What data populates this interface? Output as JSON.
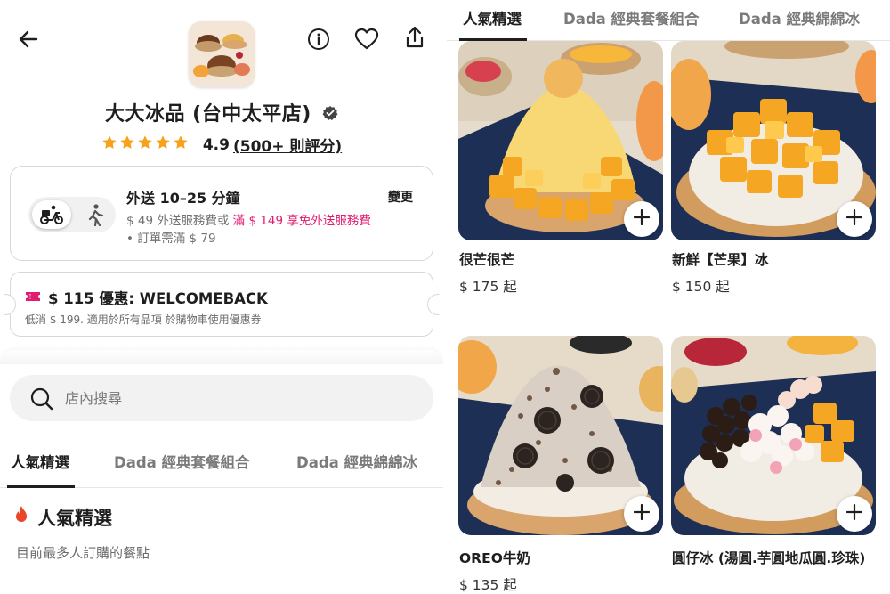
{
  "store": {
    "name": "大大冰品 (台中太平店)",
    "rating": "4.9",
    "rating_count": "(500+ 則評分)",
    "stars": 5
  },
  "delivery": {
    "title": "外送 10–25 分鐘",
    "change_label": "變更",
    "fee_prefix": "$ 49 外送服務費或",
    "fee_highlight": "滿 $ 149 享免外送服務費",
    "minimum": "• 訂單需滿 $ 79"
  },
  "promo": {
    "title": "$ 115 優惠: WELCOMEBACK",
    "desc": "低消 $ 199. 適用於所有品項 於購物車使用優惠券"
  },
  "search": {
    "placeholder": "店內搜尋"
  },
  "tabs": [
    {
      "label": "人氣精選"
    },
    {
      "label": "Dada 經典套餐組合"
    },
    {
      "label": "Dada 經典綿綿冰"
    }
  ],
  "section": {
    "title": "人氣精選",
    "subtitle": "目前最多人訂購的餐點"
  },
  "menu_items": [
    {
      "name": "很芒很芒",
      "price": "$ 175 起"
    },
    {
      "name": "新鮮【芒果】冰",
      "price": "$ 150 起"
    },
    {
      "name": "OREO牛奶",
      "price": "$ 135 起"
    },
    {
      "name": "圓仔冰 (湯圓.芋圓地瓜圓.珍珠)",
      "price": ""
    }
  ],
  "colors": {
    "accent_pink": "#e21b70",
    "star_orange": "#f7a21b",
    "text_dark": "#1e1e1e"
  },
  "icons": [
    "back-arrow-icon",
    "info-icon",
    "heart-icon",
    "share-icon",
    "verified-badge-icon",
    "scooter-icon",
    "walk-icon",
    "ticket-icon",
    "search-icon",
    "fire-icon",
    "plus-icon"
  ]
}
